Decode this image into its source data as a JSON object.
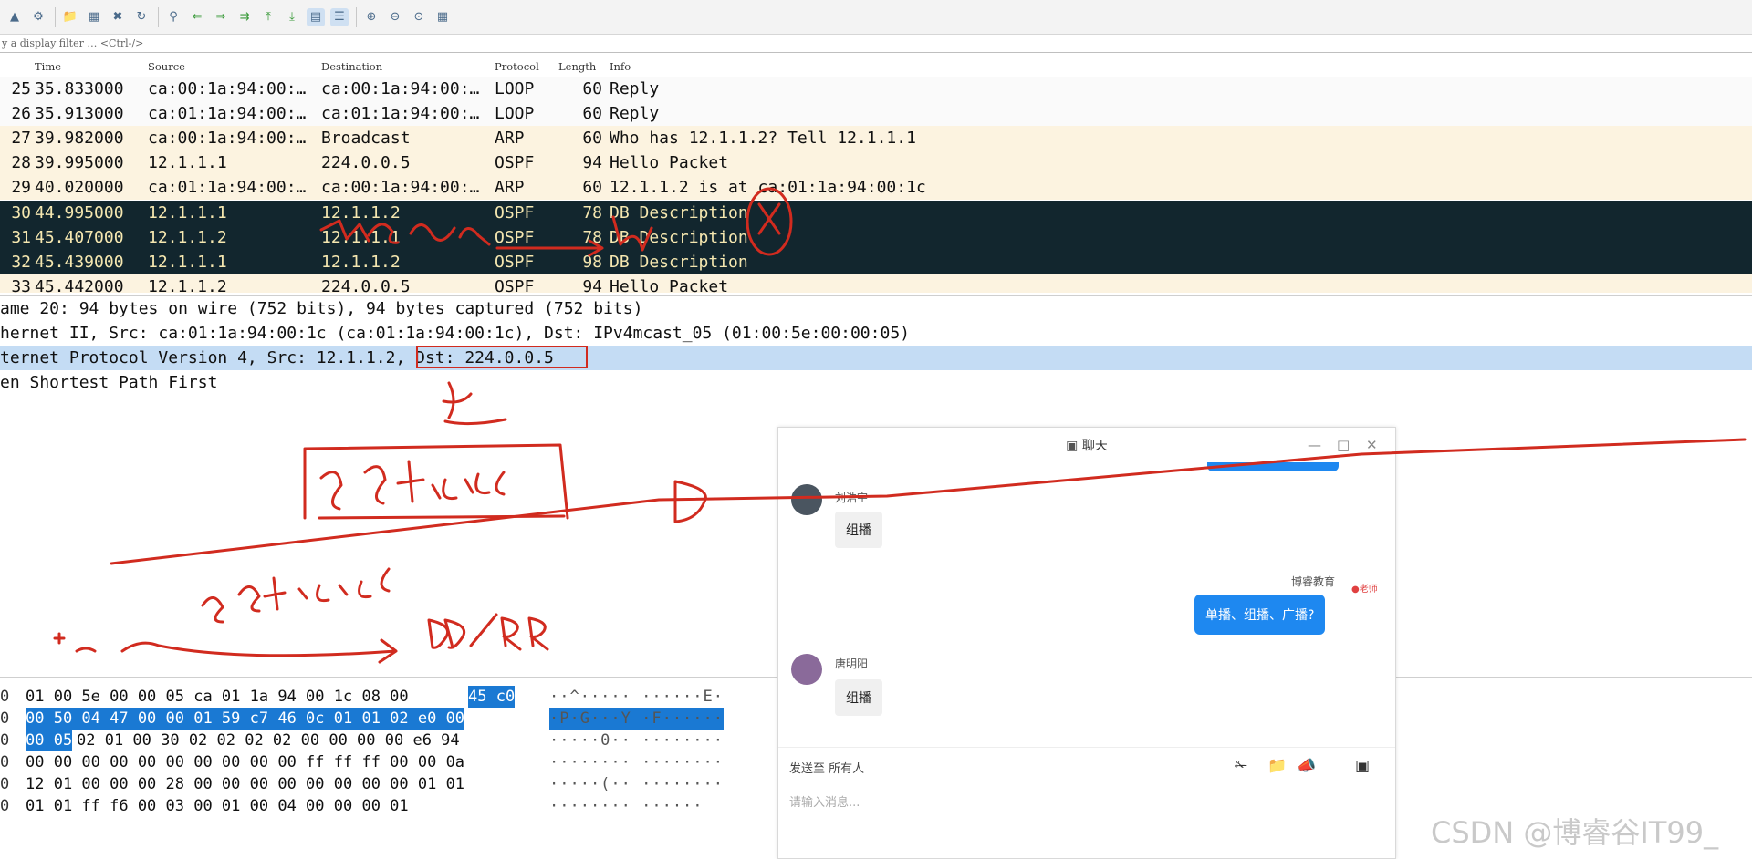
{
  "toolbar": {
    "icons": [
      "shark-fin-icon",
      "gear-icon",
      "folder-open-icon",
      "save-icon",
      "close-file-icon",
      "reload-icon",
      "find-icon",
      "back-icon",
      "forward-icon",
      "go-to-icon",
      "first-icon",
      "last-icon",
      "autoscroll-icon",
      "colorize-icon",
      "zoom-in-icon",
      "zoom-out-icon",
      "zoom-reset-icon",
      "resize-columns-icon"
    ]
  },
  "filter": {
    "placeholder": "y a display filter … <Ctrl-/>"
  },
  "packet_list": {
    "columns": [
      "Time",
      "Source",
      "Destination",
      "Protocol",
      "Length",
      "Info"
    ],
    "rows": [
      {
        "no": "25",
        "time": "35.833000",
        "src": "ca:00:1a:94:00:…",
        "dst": "ca:00:1a:94:00:…",
        "proto": "LOOP",
        "len": "60",
        "info": "Reply"
      },
      {
        "no": "26",
        "time": "35.913000",
        "src": "ca:01:1a:94:00:…",
        "dst": "ca:01:1a:94:00:…",
        "proto": "LOOP",
        "len": "60",
        "info": "Reply"
      },
      {
        "no": "27",
        "time": "39.982000",
        "src": "ca:00:1a:94:00:…",
        "dst": "Broadcast",
        "proto": "ARP",
        "len": "60",
        "info": "Who has 12.1.1.2? Tell 12.1.1.1"
      },
      {
        "no": "28",
        "time": "39.995000",
        "src": "12.1.1.1",
        "dst": "224.0.0.5",
        "proto": "OSPF",
        "len": "94",
        "info": "Hello Packet"
      },
      {
        "no": "29",
        "time": "40.020000",
        "src": "ca:01:1a:94:00:…",
        "dst": "ca:00:1a:94:00:…",
        "proto": "ARP",
        "len": "60",
        "info": "12.1.1.2 is at ca:01:1a:94:00:1c"
      },
      {
        "no": "30",
        "time": "44.995000",
        "src": "12.1.1.1",
        "dst": "12.1.1.2",
        "proto": "OSPF",
        "len": "78",
        "info": "DB Description"
      },
      {
        "no": "31",
        "time": "45.407000",
        "src": "12.1.1.2",
        "dst": "12.1.1.1",
        "proto": "OSPF",
        "len": "78",
        "info": "DB Description"
      },
      {
        "no": "32",
        "time": "45.439000",
        "src": "12.1.1.1",
        "dst": "12.1.1.2",
        "proto": "OSPF",
        "len": "98",
        "info": "DB Description"
      },
      {
        "no": "33",
        "time": "45.442000",
        "src": "12.1.1.2",
        "dst": "224.0.0.5",
        "proto": "OSPF",
        "len": "94",
        "info": "Hello Packet"
      }
    ]
  },
  "details": [
    "ame 20: 94 bytes on wire (752 bits), 94 bytes captured (752 bits)",
    "hernet II, Src: ca:01:1a:94:00:1c (ca:01:1a:94:00:1c), Dst: IPv4mcast_05 (01:00:5e:00:00:05)",
    "ternet Protocol Version 4, Src: 12.1.1.2, Dst: 224.0.0.5",
    "en Shortest Path First"
  ],
  "hex": {
    "rows": [
      {
        "off": "0",
        "plain": "01 00 5e 00 00 05 ca 01  1a 94 00 1c 08 00 ",
        "hl": "45 c0",
        "ascii": "··^····· ······E·"
      },
      {
        "off": "0",
        "plain": "",
        "hl": "00 50 04 47 00 00 01 59  c7 46 0c 01 01 02 e0 00",
        "ascii": "·P·G···Y ·F······"
      },
      {
        "off": "0",
        "plain": " 02 01 00 30 02 02  02 02 00 00 00 00 e6 94",
        "hl": "00 05",
        "ascii": "·····0·· ········"
      },
      {
        "off": "0",
        "plain": "00 00 00 00 00 00 00 00  00 00 ff ff ff 00 00 0a",
        "hl": "",
        "ascii": "········ ········"
      },
      {
        "off": "0",
        "plain": "12 01 00 00 00 28 00 00  00 00 00 00 00 00 01 01",
        "hl": "",
        "ascii": "·····(·· ········"
      },
      {
        "off": "0",
        "plain": "01 01 ff f6 00 03 00 01  00 04 00 00 00 01",
        "hl": "",
        "ascii": "········ ······"
      }
    ]
  },
  "chat": {
    "title": "聊天",
    "msg1_user": "刘浩宇",
    "msg1_text": "组播",
    "msg2_user": "博睿教育",
    "msg2_badge": "●老师",
    "msg2_text": "单播、组播、广播?",
    "msg3_user": "唐明阳",
    "msg3_text": "组播",
    "send_to": "发送至  所有人",
    "input_placeholder": "请输入消息..."
  },
  "watermark": "CSDN @博睿谷IT99_",
  "colors": {
    "selected_row_bg": "#12262e",
    "selected_row_fg": "#f5e7b0",
    "arp_row_bg": "#fcf3e0",
    "detail_highlight": "#c4dcf4",
    "hex_highlight": "#1a79d3",
    "annotation_red": "#d12b1f",
    "chat_bubble_blue": "#1e88f0"
  }
}
